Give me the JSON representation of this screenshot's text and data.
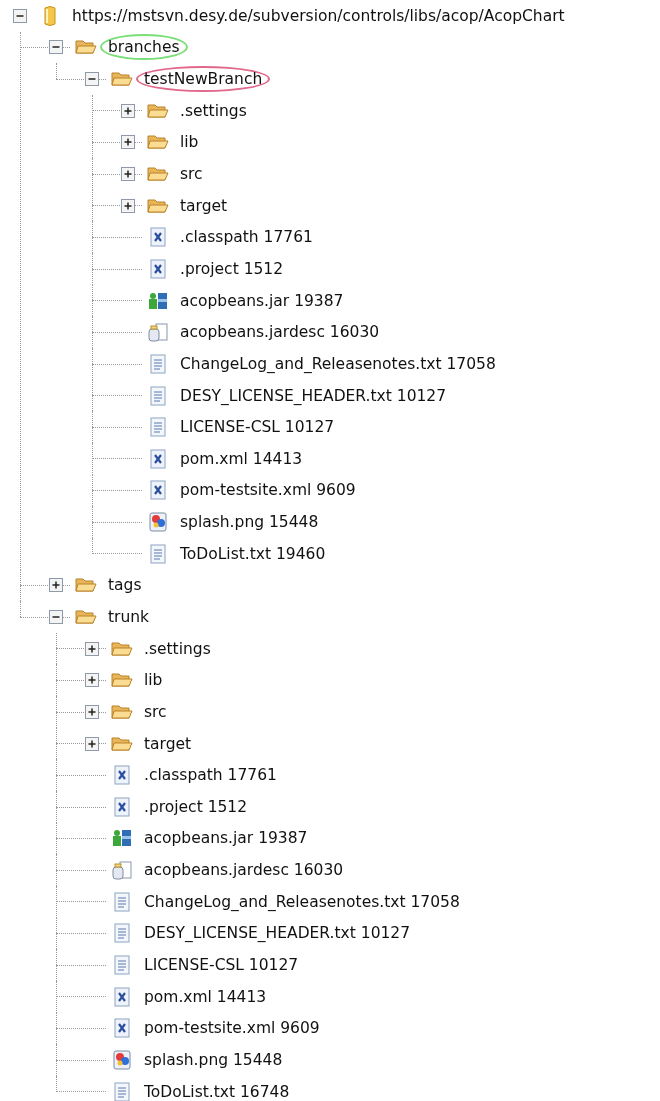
{
  "tree": {
    "label": "https://mstsvn.desy.de/subversion/controls/libs/acop/AcopChart",
    "kind": "repository",
    "expanded": true,
    "children": [
      {
        "label": "branches",
        "kind": "folder",
        "expanded": true,
        "color": "#7ade78",
        "children": [
          {
            "label": "testNewBranch",
            "kind": "folder",
            "expanded": true,
            "color": "#e0698c",
            "children": [
              {
                "label": ".settings",
                "kind": "folder",
                "expanded": false
              },
              {
                "label": "lib",
                "kind": "folder",
                "expanded": false
              },
              {
                "label": "src",
                "kind": "folder",
                "expanded": false
              },
              {
                "label": "target",
                "kind": "folder",
                "expanded": false
              },
              {
                "label": ".classpath 17761",
                "kind": "xml"
              },
              {
                "label": ".project 1512",
                "kind": "xml"
              },
              {
                "label": "acopbeans.jar 19387",
                "kind": "jar"
              },
              {
                "label": "acopbeans.jardesc 16030",
                "kind": "jardesc"
              },
              {
                "label": "ChangeLog_and_Releasenotes.txt 17058",
                "kind": "text"
              },
              {
                "label": "DESY_LICENSE_HEADER.txt 10127",
                "kind": "text"
              },
              {
                "label": "LICENSE-CSL 10127",
                "kind": "text"
              },
              {
                "label": "pom.xml 14413",
                "kind": "xml"
              },
              {
                "label": "pom-testsite.xml 9609",
                "kind": "xml"
              },
              {
                "label": "splash.png 15448",
                "kind": "image"
              },
              {
                "label": "ToDoList.txt 19460",
                "kind": "text"
              }
            ]
          }
        ]
      },
      {
        "label": "tags",
        "kind": "folder",
        "expanded": false
      },
      {
        "label": "trunk",
        "kind": "folder",
        "expanded": true,
        "children": [
          {
            "label": ".settings",
            "kind": "folder",
            "expanded": false
          },
          {
            "label": "lib",
            "kind": "folder",
            "expanded": false
          },
          {
            "label": "src",
            "kind": "folder",
            "expanded": false
          },
          {
            "label": "target",
            "kind": "folder",
            "expanded": false
          },
          {
            "label": ".classpath 17761",
            "kind": "xml"
          },
          {
            "label": ".project 1512",
            "kind": "xml"
          },
          {
            "label": "acopbeans.jar 19387",
            "kind": "jar"
          },
          {
            "label": "acopbeans.jardesc 16030",
            "kind": "jardesc"
          },
          {
            "label": "ChangeLog_and_Releasenotes.txt 17058",
            "kind": "text"
          },
          {
            "label": "DESY_LICENSE_HEADER.txt 10127",
            "kind": "text"
          },
          {
            "label": "LICENSE-CSL 10127",
            "kind": "text"
          },
          {
            "label": "pom.xml 14413",
            "kind": "xml"
          },
          {
            "label": "pom-testsite.xml 9609",
            "kind": "xml"
          },
          {
            "label": "splash.png 15448",
            "kind": "image"
          },
          {
            "label": "ToDoList.txt 16748",
            "kind": "text"
          }
        ]
      }
    ]
  }
}
